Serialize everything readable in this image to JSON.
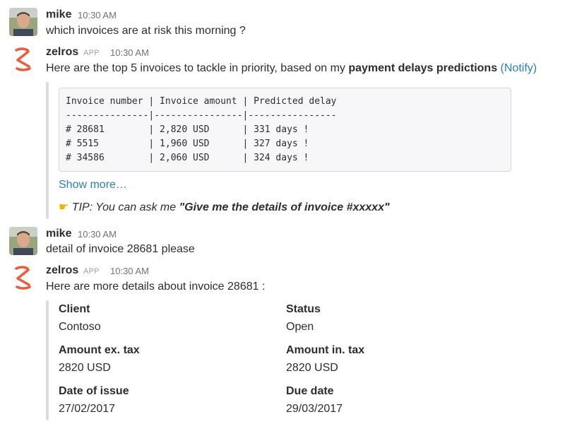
{
  "messages": [
    {
      "user": "mike",
      "time": "10:30 AM",
      "text": "which invoices are at risk this morning ?"
    },
    {
      "user": "zelros",
      "badge": "APP",
      "time": "10:30 AM",
      "text_prefix": "Here are the top 5 invoices to tackle in priority, based on my ",
      "text_bold": "payment delays predictions",
      "text_link": "(Notify)",
      "code_lines": [
        "Invoice number | Invoice amount | Predicted delay",
        "---------------|----------------|----------------",
        "# 28681        | 2,820 USD      | 331 days !",
        "# 5515         | 1,960 USD      | 327 days !",
        "# 34586        | 2,060 USD      | 324 days !"
      ],
      "show_more": "Show more…",
      "tip_prefix": "TIP: You can ask me ",
      "tip_bold": "\"Give me the details of invoice #xxxxx\""
    },
    {
      "user": "mike",
      "time": "10:30 AM",
      "text": "detail of invoice 28681 please"
    },
    {
      "user": "zelros",
      "badge": "APP",
      "time": "10:30 AM",
      "text": "Here are more details about invoice 28681 :",
      "fields": [
        {
          "label": "Client",
          "value": "Contoso"
        },
        {
          "label": "Status",
          "value": "Open"
        },
        {
          "label": "Amount ex. tax",
          "value": "2820 USD"
        },
        {
          "label": "Amount in. tax",
          "value": "2820 USD"
        },
        {
          "label": "Date of issue",
          "value": "27/02/2017"
        },
        {
          "label": "Due date",
          "value": "29/03/2017"
        }
      ]
    }
  ],
  "icons": {
    "app_icon": "zelros-logo-icon",
    "tip_icon": "pointing-hand-icon"
  },
  "colors": {
    "link": "#2a80b9",
    "zelros_brand": "#ef5a3c"
  }
}
